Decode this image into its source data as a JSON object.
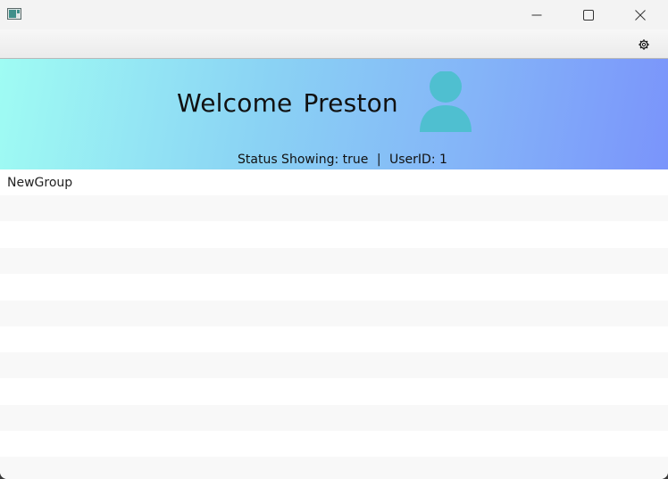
{
  "window": {
    "icon": "app-window-icon",
    "controls": {
      "minimize_icon": "minimize-icon",
      "maximize_icon": "maximize-icon",
      "close_icon": "close-icon"
    }
  },
  "toolbar": {
    "settings_icon": "gear-icon"
  },
  "header": {
    "welcome_label": "Welcome",
    "user_name": "Preston",
    "avatar_icon": "user-avatar-icon",
    "status_label": "Status Showing:",
    "status_value": "true",
    "separator": "|",
    "userid_label": "UserID:",
    "userid_value": "1",
    "colors": {
      "gradient_start": "#9ffcf3",
      "gradient_end": "#7a94fb",
      "avatar": "#4fbfd0"
    }
  },
  "list": {
    "items": [
      "NewGroup",
      "",
      "",
      "",
      "",
      "",
      "",
      "",
      "",
      "",
      "",
      ""
    ]
  }
}
